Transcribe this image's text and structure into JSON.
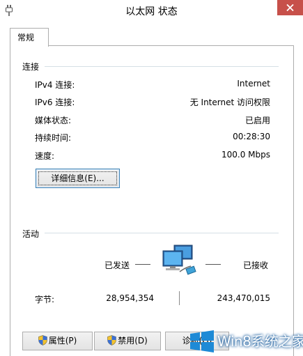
{
  "window": {
    "title": "以太网 状态"
  },
  "tab": {
    "label": "常规"
  },
  "connection": {
    "section_title": "连接",
    "rows": [
      {
        "label": "IPv4 连接:",
        "value": "Internet"
      },
      {
        "label": "IPv6 连接:",
        "value": "无 Internet 访问权限"
      },
      {
        "label": "媒体状态:",
        "value": "已启用"
      },
      {
        "label": "持续时间:",
        "value": "00:28:30"
      },
      {
        "label": "速度:",
        "value": "100.0 Mbps"
      }
    ],
    "details_button": "详细信息(E)..."
  },
  "activity": {
    "section_title": "活动",
    "sent_label": "已发送",
    "received_label": "已接收",
    "bytes_label": "字节:",
    "bytes_sent": "28,954,354",
    "bytes_received": "243,470,015"
  },
  "buttons": {
    "properties": "属性(P)",
    "disable": "禁用(D)",
    "diagnose": "诊断(G)"
  },
  "watermark": {
    "text": "Win8系统之家"
  },
  "icons": {
    "title": "network-plug-icon",
    "activity": "network-computers-icon",
    "shield": "uac-shield-icon",
    "close": "close-icon",
    "logo": "windows-logo-icon"
  },
  "colors": {
    "close_button": "#c7504a",
    "focus_border": "#3c7fb1",
    "section_line": "#d5dfe5"
  }
}
